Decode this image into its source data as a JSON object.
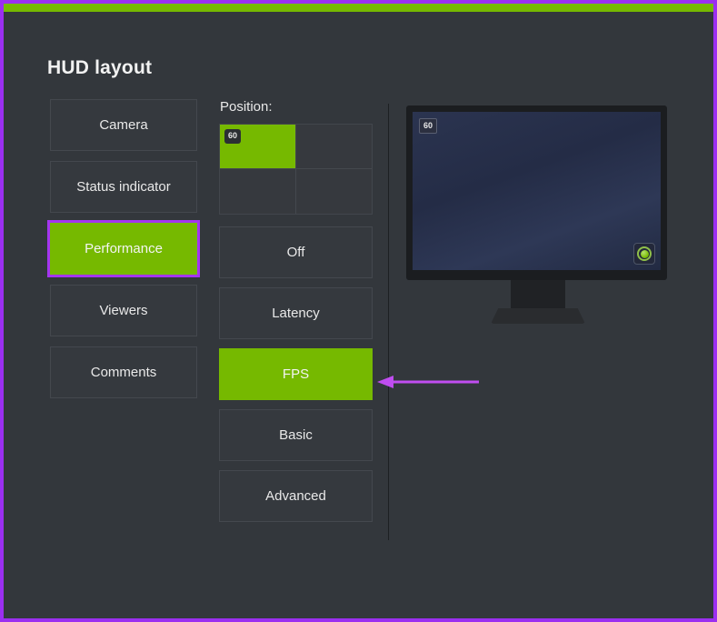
{
  "window": {
    "accent_top_color": "#76b900",
    "frame_highlight_color": "#9b2ff0",
    "background_color": "#33373c"
  },
  "header": {
    "title": "HUD layout"
  },
  "sidebar": {
    "items": [
      {
        "label": "Camera",
        "selected": false
      },
      {
        "label": "Status indicator",
        "selected": false
      },
      {
        "label": "Performance",
        "selected": true
      },
      {
        "label": "Viewers",
        "selected": false
      },
      {
        "label": "Comments",
        "selected": false
      }
    ]
  },
  "middle": {
    "position_label": "Position:",
    "position_grid": {
      "cells": [
        {
          "index": "top-left",
          "active": true,
          "chip": "60"
        },
        {
          "index": "top-right",
          "active": false,
          "chip": ""
        },
        {
          "index": "bottom-left",
          "active": false,
          "chip": ""
        },
        {
          "index": "bottom-right",
          "active": false,
          "chip": ""
        }
      ]
    },
    "options": [
      {
        "label": "Off",
        "selected": false
      },
      {
        "label": "Latency",
        "selected": false
      },
      {
        "label": "FPS",
        "selected": true
      },
      {
        "label": "Basic",
        "selected": false
      },
      {
        "label": "Advanced",
        "selected": false
      }
    ]
  },
  "preview": {
    "screen_fps_badge": "60",
    "status_icon": "green-status-indicator-icon"
  },
  "annotation": {
    "arrow_color": "#c04df0",
    "arrow_points_to": "FPS"
  }
}
